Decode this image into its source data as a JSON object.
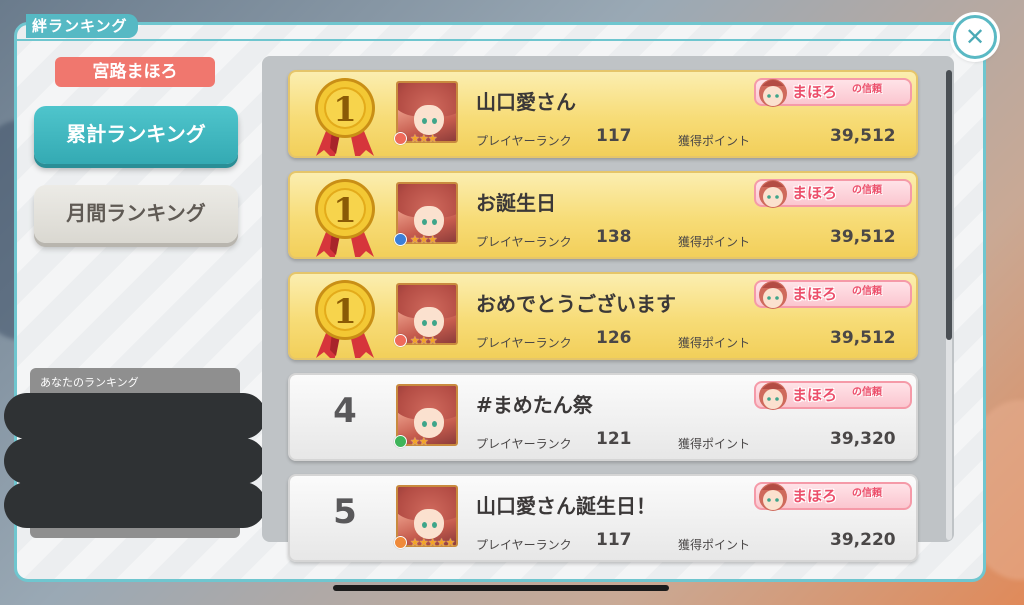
{
  "window": {
    "title": "絆ランキング"
  },
  "sidebar": {
    "character_name": "宮路まほろ",
    "tabs": [
      {
        "label": "累計ランキング",
        "active": true
      },
      {
        "label": "月間ランキング",
        "active": false
      }
    ],
    "my_ranking_label": "あなたのランキング"
  },
  "labels": {
    "player_rank": "プレイヤーランク",
    "points": "獲得ポイント"
  },
  "title_badge": {
    "main": "まほろ",
    "sub": "の信頼"
  },
  "rows": [
    {
      "rank": "1",
      "medal": true,
      "name": "山口愛さん",
      "player_rank": "117",
      "points": "39,512",
      "attr_color": "#ef6a5a",
      "stars": "★★★"
    },
    {
      "rank": "1",
      "medal": true,
      "name": "お誕生日",
      "player_rank": "138",
      "points": "39,512",
      "attr_color": "#3b7fd8",
      "stars": "★★★"
    },
    {
      "rank": "1",
      "medal": true,
      "name": "おめでとうございます",
      "player_rank": "126",
      "points": "39,512",
      "attr_color": "#ef6a5a",
      "stars": "★★★"
    },
    {
      "rank": "4",
      "medal": false,
      "name": "#まめたん祭",
      "player_rank": "121",
      "points": "39,320",
      "attr_color": "#3fb45a",
      "stars": "★★"
    },
    {
      "rank": "5",
      "medal": false,
      "name": "山口愛さん誕生日！",
      "player_rank": "117",
      "points": "39,220",
      "attr_color": "#ef8a3a",
      "stars": "★★★★★"
    }
  ],
  "colors": {
    "accent": "#4fc5cc",
    "gold_row": "#f7dc77",
    "character_tag": "#f0776e"
  }
}
